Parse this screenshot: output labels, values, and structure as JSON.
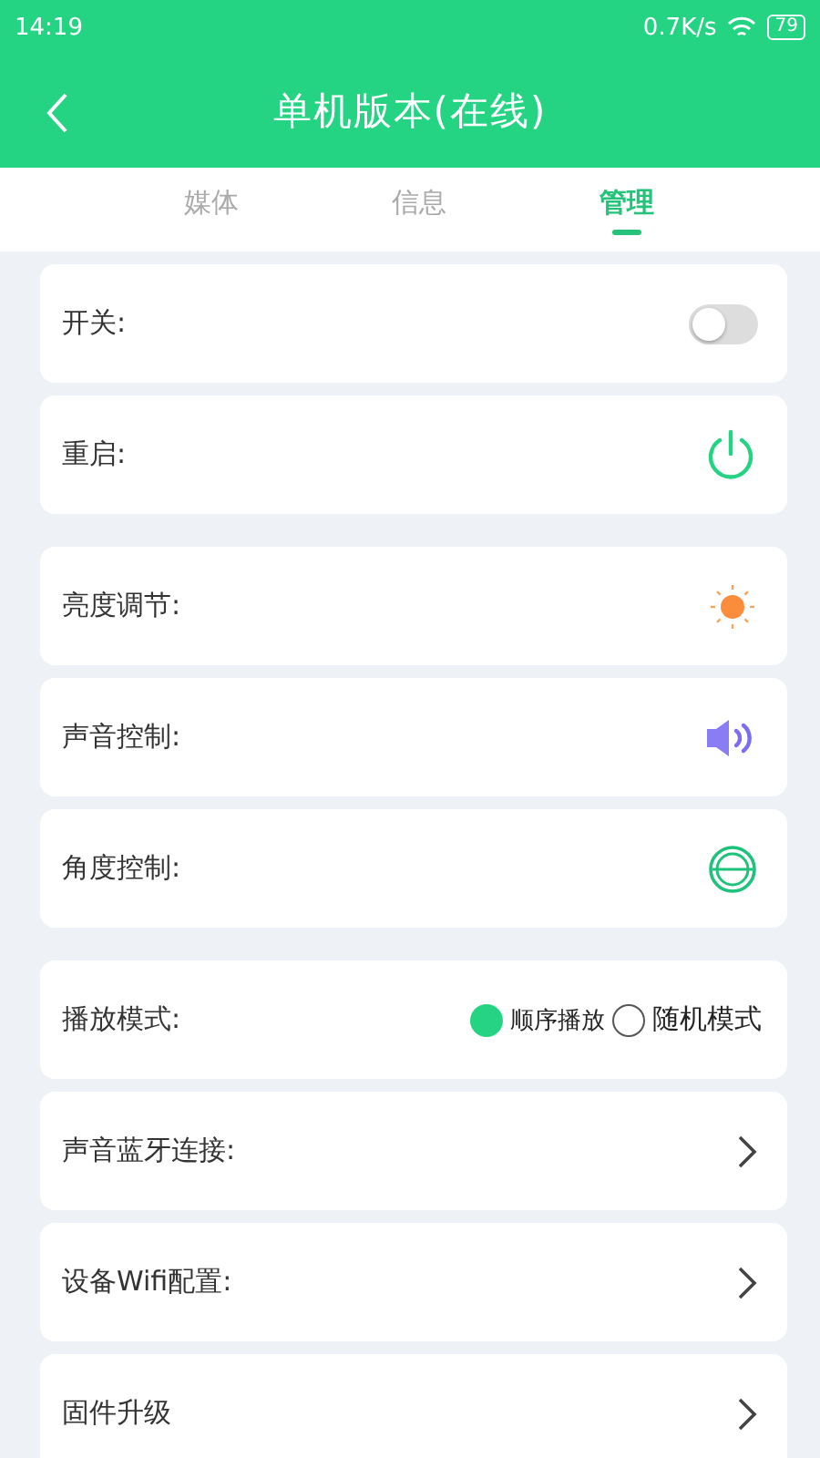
{
  "status_bar": {
    "time": "14:19",
    "speed": "0.7K/s",
    "battery": "79"
  },
  "header": {
    "title": "单机版本(在线)"
  },
  "tabs": [
    {
      "label": "媒体",
      "selected": false
    },
    {
      "label": "信息",
      "selected": false
    },
    {
      "label": "管理",
      "selected": true
    }
  ],
  "groups": [
    [
      {
        "kind": "toggle",
        "label": "开关:",
        "on": false
      },
      {
        "kind": "power",
        "label": "重启:"
      }
    ],
    [
      {
        "kind": "brightness",
        "label": "亮度调节:"
      },
      {
        "kind": "volume",
        "label": "声音控制:"
      },
      {
        "kind": "angle",
        "label": "角度控制:"
      }
    ],
    [
      {
        "kind": "radio",
        "label": "播放模式:",
        "options": [
          {
            "label": "顺序播放",
            "selected": true
          },
          {
            "label": "随机模式",
            "selected": false
          }
        ]
      },
      {
        "kind": "link",
        "label": "声音蓝牙连接:"
      },
      {
        "kind": "link",
        "label": "设备Wifi配置:"
      },
      {
        "kind": "link",
        "label": "固件升级"
      }
    ]
  ]
}
